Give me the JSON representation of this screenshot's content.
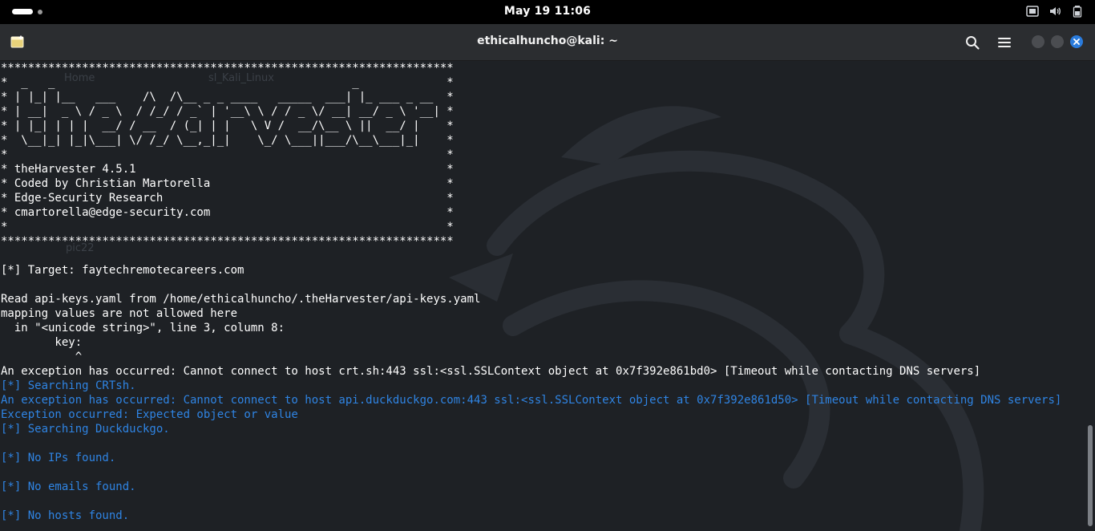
{
  "topbar": {
    "clock": "May 19  11:06",
    "tray": [
      {
        "icon": "screenshot-indicator-icon"
      },
      {
        "icon": "volume-icon"
      },
      {
        "icon": "power-battery-icon"
      }
    ]
  },
  "window": {
    "title": "ethicalhuncho@kali: ~",
    "new_tab_icon": "new-tab-icon",
    "search_icon": "search-icon",
    "menu_icon": "hamburger-menu-icon",
    "close_color": "#2a7bdc"
  },
  "desktop_behind": {
    "labels": [
      "Home",
      "sl_Kali_Linux",
      "pic22"
    ]
  },
  "terminal": {
    "colors": {
      "white": "#ffffff",
      "blue": "#2f84e3",
      "background": "#1e2125"
    },
    "lines": [
      {
        "text": "*******************************************************************",
        "style": "white"
      },
      {
        "text": "*  _   _                                            _             *",
        "style": "white"
      },
      {
        "text": "* | |_| |__   ___    /\\  /\\__ _ _ ____   _____  ___| |_ ___ _ __  *",
        "style": "white"
      },
      {
        "text": "* | __|  _ \\ / _ \\  / /_/ / _` | '__\\ \\ / / _ \\/ __| __/ _ \\ '__| *",
        "style": "white"
      },
      {
        "text": "* | |_| | | |  __/ / __  / (_| | |   \\ V /  __/\\__ \\ ||  __/ |    *",
        "style": "white"
      },
      {
        "text": "*  \\__|_| |_|\\___| \\/ /_/ \\__,_|_|    \\_/ \\___||___/\\__\\___|_|    *",
        "style": "white"
      },
      {
        "text": "*                                                                 *",
        "style": "white"
      },
      {
        "text": "* theHarvester 4.5.1                                              *",
        "style": "white"
      },
      {
        "text": "* Coded by Christian Martorella                                   *",
        "style": "white"
      },
      {
        "text": "* Edge-Security Research                                          *",
        "style": "white"
      },
      {
        "text": "* cmartorella@edge-security.com                                   *",
        "style": "white"
      },
      {
        "text": "*                                                                 *",
        "style": "white"
      },
      {
        "text": "*******************************************************************",
        "style": "white"
      },
      {
        "text": "",
        "style": "white"
      },
      {
        "text": "[*] Target: faytechremotecareers.com",
        "style": "white"
      },
      {
        "text": "",
        "style": "white"
      },
      {
        "text": "Read api-keys.yaml from /home/ethicalhuncho/.theHarvester/api-keys.yaml",
        "style": "white"
      },
      {
        "text": "mapping values are not allowed here",
        "style": "white"
      },
      {
        "text": "  in \"<unicode string>\", line 3, column 8:",
        "style": "white"
      },
      {
        "text": "        key:",
        "style": "white"
      },
      {
        "text": "           ^",
        "style": "white"
      },
      {
        "text": "An exception has occurred: Cannot connect to host crt.sh:443 ssl:<ssl.SSLContext object at 0x7f392e861bd0> [Timeout while contacting DNS servers]",
        "style": "white"
      },
      {
        "text": "[*] Searching CRTsh.",
        "style": "blue"
      },
      {
        "text": "An exception has occurred: Cannot connect to host api.duckduckgo.com:443 ssl:<ssl.SSLContext object at 0x7f392e861d50> [Timeout while contacting DNS servers]",
        "style": "blue"
      },
      {
        "text": "Exception occurred: Expected object or value",
        "style": "blue"
      },
      {
        "text": "[*] Searching Duckduckgo.",
        "style": "blue"
      },
      {
        "text": "",
        "style": "blue"
      },
      {
        "text": "[*] No IPs found.",
        "style": "blue"
      },
      {
        "text": "",
        "style": "blue"
      },
      {
        "text": "[*] No emails found.",
        "style": "blue"
      },
      {
        "text": "",
        "style": "blue"
      },
      {
        "text": "[*] No hosts found.",
        "style": "blue"
      }
    ]
  }
}
